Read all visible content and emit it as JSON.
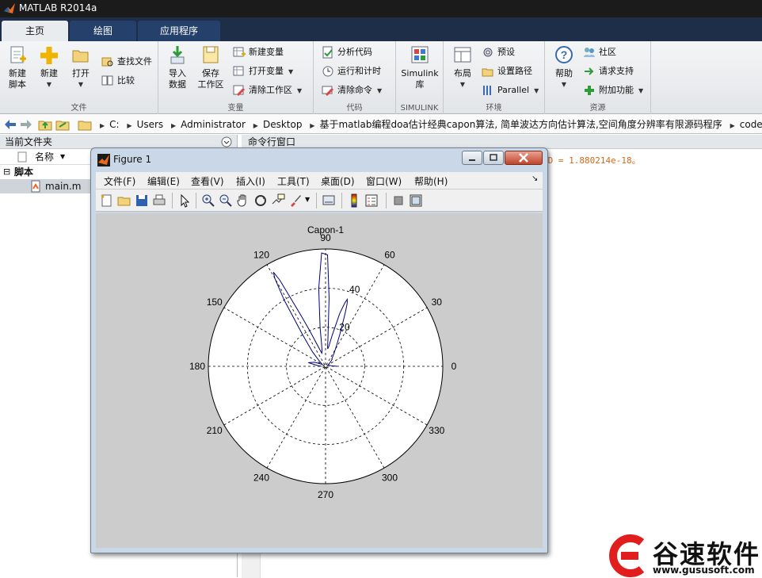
{
  "app": {
    "title": "MATLAB R2014a"
  },
  "tabs": [
    {
      "label": "主页",
      "active": true
    },
    {
      "label": "绘图",
      "active": false
    },
    {
      "label": "应用程序",
      "active": false
    }
  ],
  "ribbon": {
    "file": {
      "group_label": "文件",
      "new_script": "新建\n脚本",
      "new": "新建",
      "open": "打开",
      "find_files": "查找文件",
      "compare": "比较"
    },
    "variable": {
      "group_label": "变量",
      "import": "导入\n数据",
      "save_workspace": "保存\n工作区",
      "new_variable": "新建变量",
      "open_variable": "打开变量",
      "clear_workspace": "清除工作区"
    },
    "code": {
      "group_label": "代码",
      "analyze": "分析代码",
      "run_time": "运行和计时",
      "clear_commands": "清除命令"
    },
    "simulink": {
      "group_label": "SIMULINK",
      "library": "Simulink\n库"
    },
    "environment": {
      "group_label": "环境",
      "layout": "布局",
      "preferences": "预设",
      "set_path": "设置路径",
      "parallel": "Parallel"
    },
    "resources": {
      "group_label": "资源",
      "help": "帮助",
      "community": "社区",
      "request_support": "请求支持",
      "addons": "附加功能"
    }
  },
  "address": {
    "crumbs": [
      "C:",
      "Users",
      "Administrator",
      "Desktop",
      "基于matlab编程doa估计经典capon算法, 简单波达方向估计算法,空间角度分辨率有限源码程序",
      "code"
    ]
  },
  "current_folder": {
    "title": "当前文件夹",
    "column_name": "名称",
    "group": "脚本",
    "files": [
      "main.m"
    ]
  },
  "command_window": {
    "title": "命令行窗口",
    "visible_output": "ND =  1.880214e-18。"
  },
  "figure": {
    "title": "Figure 1",
    "menus": [
      "文件(F)",
      "编辑(E)",
      "查看(V)",
      "插入(I)",
      "工具(T)",
      "桌面(D)",
      "窗口(W)",
      "帮助(H)"
    ],
    "toolbar_icons": [
      "new-figure-icon",
      "open-file-icon",
      "save-icon",
      "print-icon",
      "pointer-icon",
      "zoom-in-icon",
      "zoom-out-icon",
      "pan-icon",
      "rotate-icon",
      "data-cursor-icon",
      "brush-icon",
      "link-plot-icon",
      "colorbar-icon",
      "legend-icon",
      "hide-plot-tools-icon",
      "show-plot-tools-icon"
    ]
  },
  "chart_data": {
    "type": "polar-line",
    "title": "Capon-1",
    "angle_ticks_deg": [
      0,
      30,
      60,
      90,
      120,
      150,
      180,
      210,
      240,
      270,
      300,
      330
    ],
    "radial_ticks": [
      20,
      40
    ],
    "rmax": 60,
    "grid": true,
    "series": [
      {
        "color": "#00007f",
        "theta_deg": [
          0,
          5,
          15,
          25,
          35,
          40,
          44,
          47,
          50,
          53,
          57,
          62,
          66,
          69,
          70,
          71,
          72,
          73,
          75,
          78,
          81,
          83,
          84,
          85,
          86,
          87,
          89,
          92,
          95,
          98,
          100,
          103,
          106,
          110,
          114,
          116,
          117,
          118,
          119,
          120,
          122,
          126,
          132,
          140,
          150,
          155,
          160,
          168,
          175,
          180
        ],
        "r": [
          6,
          3,
          2,
          1.5,
          2,
          3,
          4,
          5,
          5,
          6,
          8,
          12,
          18,
          26,
          30,
          34,
          36,
          34,
          28,
          16,
          10,
          9,
          10,
          14,
          20,
          35,
          57,
          58,
          40,
          20,
          12,
          8,
          7,
          10,
          20,
          30,
          38,
          50,
          55,
          52,
          40,
          20,
          10,
          4,
          2,
          3,
          6,
          9,
          4,
          2
        ]
      }
    ]
  },
  "watermark": {
    "text": "谷速软件",
    "url": "www.gususoft.com"
  }
}
